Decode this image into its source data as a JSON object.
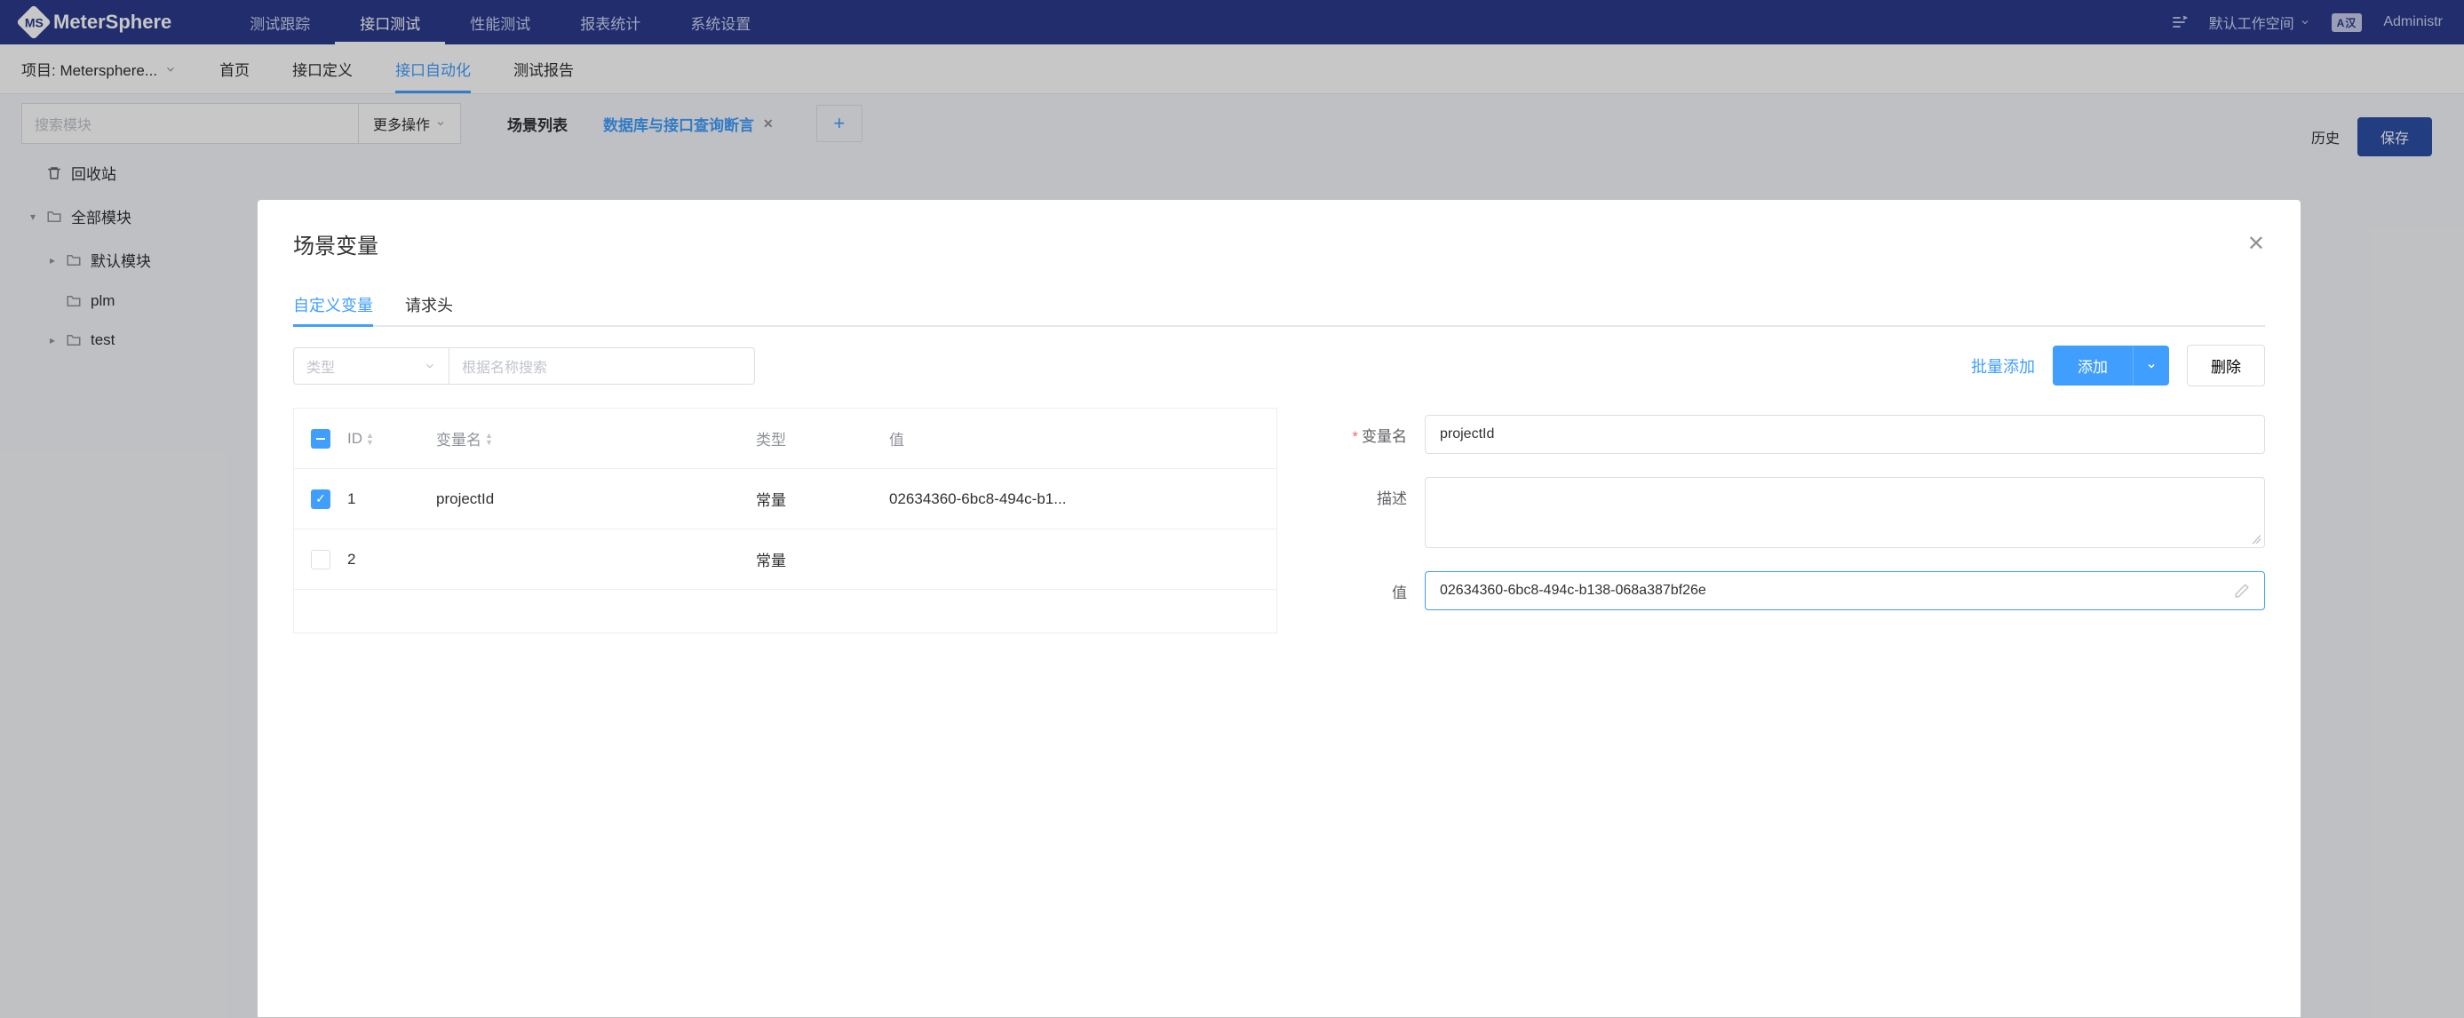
{
  "top_nav": {
    "brand": "MeterSphere",
    "items": [
      "测试跟踪",
      "接口测试",
      "性能测试",
      "报表统计",
      "系统设置"
    ],
    "active_index": 1,
    "workspace": "默认工作空间",
    "lang": "A汉",
    "user": "Administr"
  },
  "sub_nav": {
    "project_label": "项目: Metersphere...",
    "items": [
      "首页",
      "接口定义",
      "接口自动化",
      "测试报告"
    ],
    "active_index": 2
  },
  "toolbar": {
    "search_placeholder": "搜索模块",
    "more_ops": "更多操作",
    "tabs": [
      {
        "label": "场景列表",
        "closable": false,
        "blue": false
      },
      {
        "label": "数据库与接口查询断言",
        "closable": true,
        "blue": true
      }
    ]
  },
  "right_actions": {
    "history": "历史",
    "save": "保存"
  },
  "tree": {
    "recycle": "回收站",
    "all_modules": "全部模块",
    "children": [
      "默认模块",
      "plm",
      "test"
    ]
  },
  "modal": {
    "title": "场景变量",
    "tabs": [
      "自定义变量",
      "请求头"
    ],
    "active_tab": 0,
    "type_placeholder": "类型",
    "name_search_placeholder": "根据名称搜索",
    "batch_add": "批量添加",
    "add_btn": "添加",
    "delete_btn": "删除",
    "table": {
      "headers": {
        "id": "ID",
        "name": "变量名",
        "type": "类型",
        "value": "值"
      },
      "rows": [
        {
          "id": "1",
          "checked": true,
          "name": "projectId",
          "type": "常量",
          "value": "02634360-6bc8-494c-b1..."
        },
        {
          "id": "2",
          "checked": false,
          "name": "",
          "type": "常量",
          "value": ""
        }
      ]
    },
    "form": {
      "var_name_label": "变量名",
      "var_name_value": "projectId",
      "desc_label": "描述",
      "desc_value": "",
      "value_label": "值",
      "value_value": "02634360-6bc8-494c-b138-068a387bf26e"
    }
  }
}
